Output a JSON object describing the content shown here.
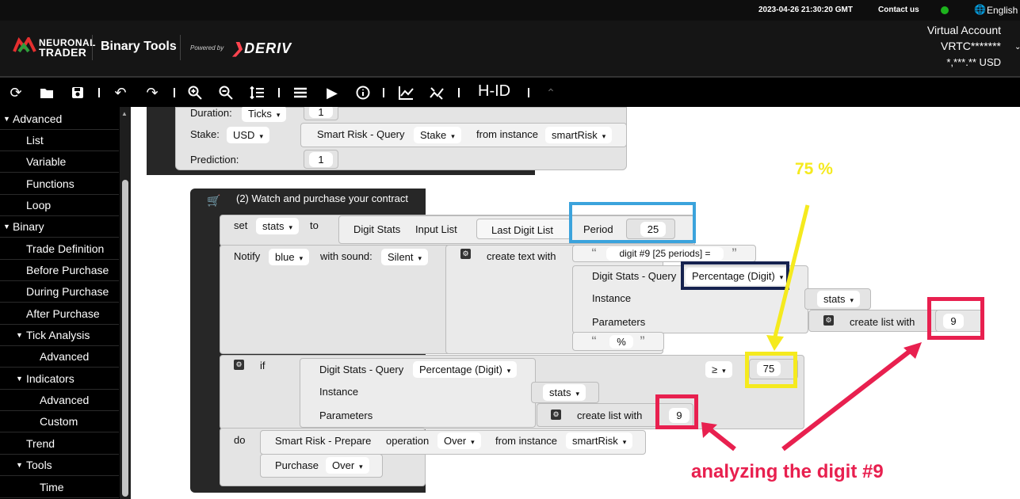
{
  "topbar": {
    "datetime": "2023-04-26 21:30:20 GMT",
    "contact": "Contact us",
    "language": "English",
    "status_color": "#1db31d"
  },
  "header": {
    "brand_line1": "NEURONAL",
    "brand_line2": "TRADER",
    "app_title": "Binary Tools",
    "powered_by": "Powered by",
    "deriv": "DERIV",
    "account_type": "Virtual Account",
    "account_id": "VRTC*******",
    "balance": "*,***.** USD"
  },
  "toolbar": {
    "label": "H-ID",
    "icons": [
      "reset-icon",
      "open-icon",
      "save-icon",
      "undo-icon",
      "redo-icon",
      "zoom-in-icon",
      "zoom-out-icon",
      "sort-icon",
      "logs-icon",
      "run-icon",
      "info-icon",
      "chart-icon",
      "trading-view-icon",
      "h-id",
      "collapse-icon"
    ]
  },
  "sidebar": {
    "items": [
      {
        "label": "Advanced",
        "level": 0,
        "expanded": true
      },
      {
        "label": "List",
        "level": 1
      },
      {
        "label": "Variable",
        "level": 1
      },
      {
        "label": "Functions",
        "level": 1
      },
      {
        "label": "Loop",
        "level": 1
      },
      {
        "label": "Binary",
        "level": 0,
        "expanded": true
      },
      {
        "label": "Trade Definition",
        "level": 1
      },
      {
        "label": "Before Purchase",
        "level": 1
      },
      {
        "label": "During Purchase",
        "level": 1
      },
      {
        "label": "After Purchase",
        "level": 1
      },
      {
        "label": "Tick Analysis",
        "level": 1,
        "expanded": true
      },
      {
        "label": "Advanced",
        "level": 2
      },
      {
        "label": "Indicators",
        "level": 1,
        "expanded": true
      },
      {
        "label": "Advanced",
        "level": 2
      },
      {
        "label": "Custom",
        "level": 2
      },
      {
        "label": "Trend",
        "level": 1
      },
      {
        "label": "Tools",
        "level": 1,
        "expanded": true
      },
      {
        "label": "Time",
        "level": 2
      }
    ]
  },
  "trade_block": {
    "duration_label": "Duration:",
    "duration_unit": "Ticks",
    "duration_value": "1",
    "stake_label": "Stake:",
    "currency": "USD",
    "smart_risk_query": "Smart Risk - Query",
    "stake_option": "Stake",
    "from_instance": "from instance",
    "instance_name": "smartRisk",
    "prediction_label": "Prediction:",
    "prediction_value": "1"
  },
  "purchase_block": {
    "title": "(2) Watch and purchase your contract",
    "set": "set",
    "var_name": "stats",
    "to": "to",
    "digit_stats": "Digit Stats",
    "input_list": "Input List",
    "last_digit_list": "Last Digit List",
    "period_label": "Period",
    "period_value": "25",
    "notify": "Notify",
    "color": "blue",
    "with_sound": "with sound:",
    "sound": "Silent",
    "create_text_with": "create text with",
    "text1": "digit #9 [25 periods] =",
    "digit_stats_query": "Digit Stats - Query",
    "percentage_digit": "Percentage (Digit)",
    "instance": "Instance",
    "instance_value": "stats",
    "parameters": "Parameters",
    "create_list_with": "create list with",
    "param_digit": "9",
    "text2": "%",
    "if": "if",
    "compare_op": "≥",
    "threshold": "75",
    "do": "do",
    "smart_risk_prepare": "Smart Risk - Prepare",
    "operation": "operation",
    "op_value": "Over",
    "from_instance": "from instance",
    "instance_name": "smartRisk",
    "purchase": "Purchase",
    "purchase_value": "Over"
  },
  "annotations": {
    "pct_label": "75 %",
    "digit_label": "analyzing the digit #9",
    "yellow": "#f5ea1e",
    "pink": "#e8204f",
    "blue": "#3ba3dc",
    "navy": "#16224f"
  }
}
